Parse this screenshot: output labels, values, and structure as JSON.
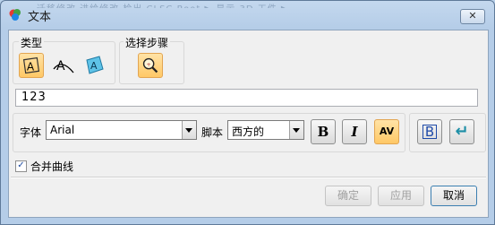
{
  "window": {
    "title": "文本",
    "background_tabs": "迁移修改   进给修改   检出 CLSC   Root   ▶ 显示 3D 工件   ▶"
  },
  "type_group": {
    "label": "类型",
    "icons": [
      "planar-text-icon",
      "on-curve-text-icon",
      "on-face-text-icon"
    ]
  },
  "step_group": {
    "label": "选择步骤",
    "icons": [
      "select-point-icon"
    ]
  },
  "text_field": {
    "value": "123"
  },
  "font_row": {
    "font_label": "字体",
    "font_value": "Arial",
    "script_label": "脚本",
    "script_value": "西方的",
    "bold_glyph": "B",
    "italic_glyph": "I",
    "spacing_glyph": "AV",
    "frame_glyph": "B",
    "apply_glyph": "↵"
  },
  "merge_curves": {
    "label": "合并曲线",
    "checked": true,
    "mark": "✓"
  },
  "buttons": {
    "ok": "确定",
    "apply": "应用",
    "cancel": "取消"
  },
  "colors": {
    "selected_fill": "#ffc866",
    "selected_border": "#e2a552",
    "window_frame": "#b9d1ea"
  }
}
